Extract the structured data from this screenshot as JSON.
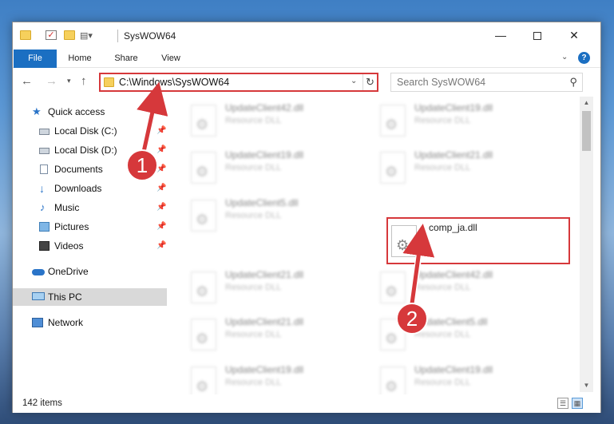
{
  "window": {
    "title": "SysWOW64",
    "controls": {
      "minimize": "—",
      "maximize": "",
      "close": "✕"
    }
  },
  "ribbon": {
    "tabs": [
      {
        "label": "File"
      },
      {
        "label": "Home"
      },
      {
        "label": "Share"
      },
      {
        "label": "View"
      }
    ],
    "help": "?"
  },
  "navigation": {
    "address": "C:\\Windows\\SysWOW64",
    "search_placeholder": "Search SysWOW64"
  },
  "sidebar": {
    "items": [
      {
        "label": "Quick access",
        "icon": "star-icon",
        "pinned": false
      },
      {
        "label": "Local Disk (C:)",
        "icon": "drive-icon",
        "pinned": true
      },
      {
        "label": "Local Disk (D:)",
        "icon": "drive-icon",
        "pinned": true
      },
      {
        "label": "Documents",
        "icon": "documents-icon",
        "pinned": true
      },
      {
        "label": "Downloads",
        "icon": "download-icon",
        "pinned": true
      },
      {
        "label": "Music",
        "icon": "music-icon",
        "pinned": true
      },
      {
        "label": "Pictures",
        "icon": "pictures-icon",
        "pinned": true
      },
      {
        "label": "Videos",
        "icon": "videos-icon",
        "pinned": true
      },
      {
        "label": "OneDrive",
        "icon": "cloud-icon",
        "pinned": false
      },
      {
        "label": "This PC",
        "icon": "computer-icon",
        "pinned": false,
        "selected": true
      },
      {
        "label": "Network",
        "icon": "network-icon",
        "pinned": false
      }
    ]
  },
  "files": [
    {
      "name": "UpdateClient42.dll",
      "type": "Resource DLL"
    },
    {
      "name": "UpdateClient19.dll",
      "type": "Resource DLL"
    },
    {
      "name": "UpdateClient19.dll",
      "type": "Resource DLL"
    },
    {
      "name": "UpdateClient21.dll",
      "type": "Resource DLL"
    },
    {
      "name": "UpdateClient5.dll",
      "type": "Resource DLL"
    },
    {
      "name": "comp_ja.dll",
      "type": "",
      "highlighted": true
    },
    {
      "name": "UpdateClient21.dll",
      "type": "Resource DLL"
    },
    {
      "name": "UpdateClient42.dll",
      "type": "Resource DLL"
    },
    {
      "name": "UpdateClient21.dll",
      "type": "Resource DLL"
    },
    {
      "name": "UpdateClient5.dll",
      "type": "Resource DLL"
    },
    {
      "name": "UpdateClient19.dll",
      "type": "Resource DLL"
    },
    {
      "name": "UpdateClient19.dll",
      "type": "Resource DLL"
    }
  ],
  "status": {
    "item_count": "142 items"
  },
  "annotations": [
    {
      "label": "1",
      "target": "address-bar"
    },
    {
      "label": "2",
      "target": "comp_ja.dll"
    }
  ],
  "colors": {
    "accent": "#1b6fc2",
    "annotation_red": "#d6383b",
    "folder_yellow": "#f6d05c"
  }
}
